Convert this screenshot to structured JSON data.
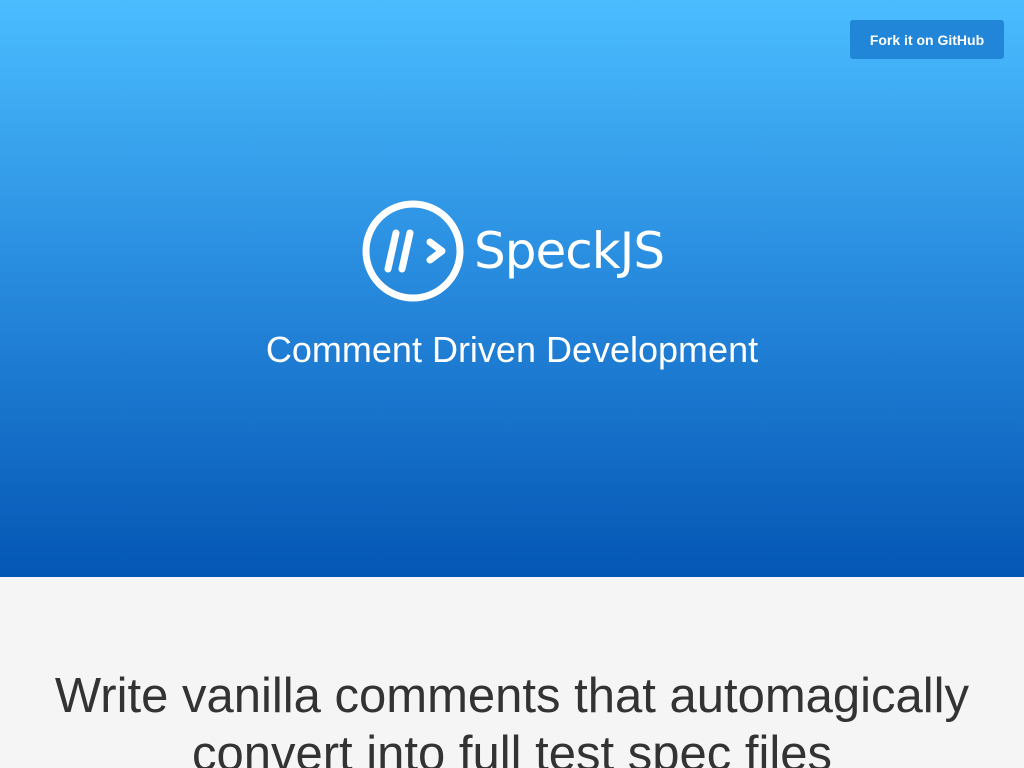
{
  "header": {
    "fork_label": "Fork it on GitHub"
  },
  "hero": {
    "logo_text": "SpeckJS",
    "tagline": "Comment Driven Development"
  },
  "main": {
    "headline": "Write vanilla comments that automagically convert into full test spec files"
  },
  "colors": {
    "hero_top": "#4bbdff",
    "hero_bottom": "#0456b4",
    "button": "#2185d8",
    "content_bg": "#f5f5f5",
    "headline_text": "#333333"
  }
}
